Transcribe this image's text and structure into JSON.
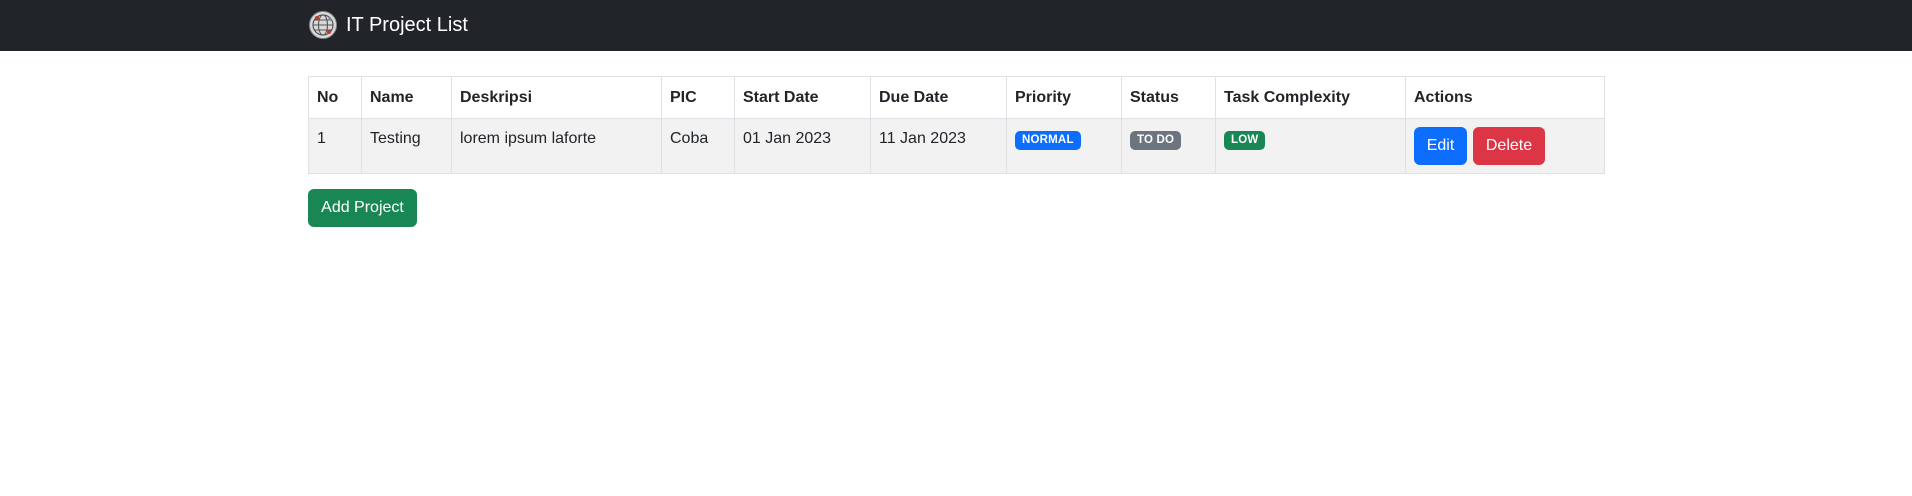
{
  "navbar": {
    "title": "IT Project List",
    "logo_icon": "globe-logo-icon"
  },
  "table": {
    "headers": [
      "No",
      "Name",
      "Deskripsi",
      "PIC",
      "Start Date",
      "Due Date",
      "Priority",
      "Status",
      "Task Complexity",
      "Actions"
    ],
    "rows": [
      {
        "no": "1",
        "name": "Testing",
        "deskripsi": "lorem ipsum laforte",
        "pic": "Coba",
        "start_date": "01 Jan 2023",
        "due_date": "11 Jan 2023",
        "priority": "NORMAL",
        "status": "TO DO",
        "complexity": "LOW",
        "edit_label": "Edit",
        "delete_label": "Delete"
      }
    ]
  },
  "badge_colors": {
    "priority": "#0d6efd",
    "status": "#6c757d",
    "complexity": "#198754"
  },
  "button_colors": {
    "edit": "#0d6efd",
    "delete": "#dc3545",
    "add": "#198754"
  },
  "add_button_label": "Add Project"
}
